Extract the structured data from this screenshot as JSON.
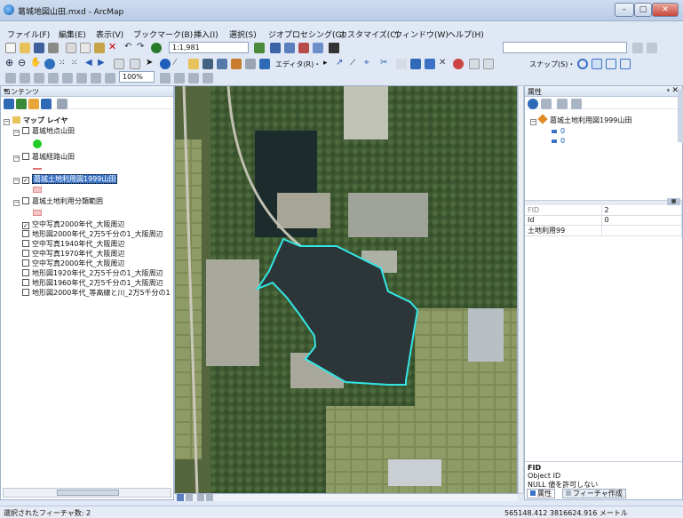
{
  "window": {
    "title": "葛城地図山田.mxd - ArcMap"
  },
  "menu": [
    "ファイル(F)",
    "編集(E)",
    "表示(V)",
    "ブックマーク(B)",
    "挿入(I)",
    "選択(S)",
    "ジオプロセシング(G)",
    "カスタマイズ(C)",
    "ウィンドウ(W)",
    "ヘルプ(H)"
  ],
  "toolbar": {
    "scale": "1:1,981",
    "editor_label": "エディタ(R)・",
    "snap_label": "スナップ(S)・",
    "zoom_value": "100%"
  },
  "toc": {
    "title": "コンテンツ",
    "root": "マップ レイヤ",
    "layers": [
      {
        "label": "葛城地点山田",
        "checked": false
      },
      {
        "label": "葛城経路山田",
        "checked": false
      },
      {
        "label": "葛城土地利用図1999山田",
        "checked": true
      },
      {
        "label": "葛城土地利用分類範囲",
        "checked": false
      },
      {
        "label": "空中写真2000年代_大阪周辺",
        "checked": true
      },
      {
        "label": "地形図2000年代_2万5千分の1_大阪周辺",
        "checked": false
      },
      {
        "label": "空中写真1940年代_大阪周辺",
        "checked": false
      },
      {
        "label": "空中写真1970年代_大阪周辺",
        "checked": false
      },
      {
        "label": "空中写真2000年代_大阪周辺",
        "checked": false
      },
      {
        "label": "地形図1920年代_2万5千分の1_大阪周辺",
        "checked": false
      },
      {
        "label": "地形図1960年代_2万5千分の1_大阪周辺",
        "checked": false
      },
      {
        "label": "地形図2000年代_等高線と川_2万5千分の1",
        "checked": false
      }
    ]
  },
  "attributes": {
    "title": "属性",
    "layer": "葛城土地利用図1999山田",
    "items": [
      "0",
      "0"
    ],
    "rows": [
      {
        "field": "FID",
        "value": "2"
      },
      {
        "field": "Id",
        "value": "0"
      },
      {
        "field": "土地利用99",
        "value": ""
      }
    ],
    "desc_title": "FID",
    "desc_line1": "Object ID",
    "desc_line2": "NULL 値を許可しない",
    "tab_attr": "属性",
    "tab_create": "フィーチャ作成"
  },
  "status": {
    "left": "選択されたフィーチャ数: 2",
    "coords": "565148.412  3816624.916 メートル"
  },
  "colors": {
    "selection": "#33e6e6",
    "point_symbol": "#22cc22",
    "polygon_symbol": "#f4c6c6"
  }
}
